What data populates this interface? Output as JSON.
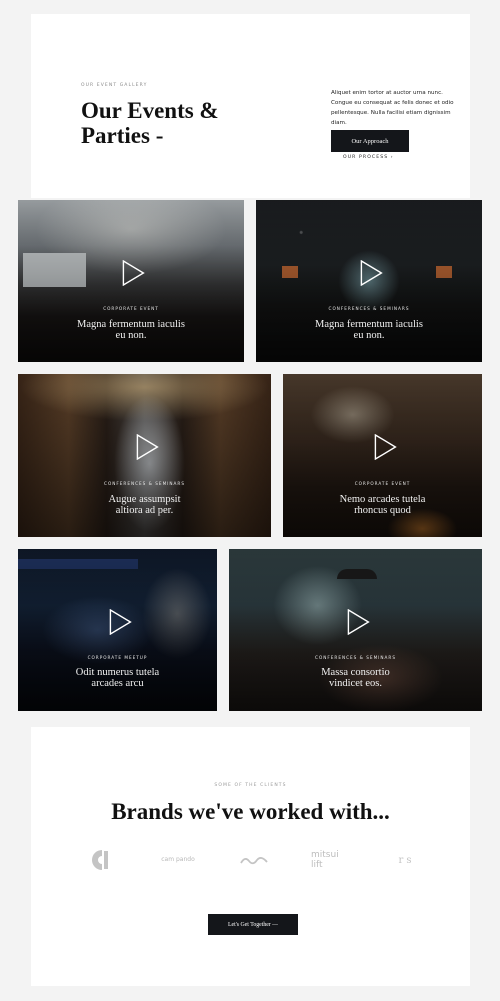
{
  "header": {
    "eyebrow": "OUR EVENT GALLERY",
    "title": "Our Events & Parties -",
    "description": "Aliquet enim tortor at auctor urna nunc. Congue eu consequat ac felis donec et odio pellentesque. Nulla facilisi etiam dignissim diam.",
    "approach_button": "Our Approach",
    "process_link": "OUR PROCESS  ›"
  },
  "events": [
    {
      "tag": "CORPORATE EVENT",
      "title": "Magna fermentum iaculis eu non."
    },
    {
      "tag": "CONFERENCES & SEMINARS",
      "title": "Magna fermentum iaculis eu non."
    },
    {
      "tag": "CONFERENCES & SEMINARS",
      "title": "Augue assumpsit altiora ad per."
    },
    {
      "tag": "CORPORATE EVENT",
      "title": "Nemo arcades tutela rhoncus quod"
    },
    {
      "tag": "CORPORATE MEETUP",
      "title": "Odit numerus tutela arcades arcu"
    },
    {
      "tag": "CONFERENCES & SEMINARS",
      "title": "Massa consortio vindicet eos."
    }
  ],
  "clients": {
    "eyebrow": "SOME OF THE CLIENTS",
    "title": "Brands we've worked with...",
    "logos": [
      "c-logo-icon",
      "cam pando",
      "wave-logo-icon",
      "mitsui lift",
      "r s"
    ],
    "cta_button": "Let's Get Together —"
  },
  "colors": {
    "page_bg": "#f3f3f3",
    "card_bg": "#ffffff",
    "button_bg": "#14161a",
    "logo_gray": "#c4c4c4"
  }
}
